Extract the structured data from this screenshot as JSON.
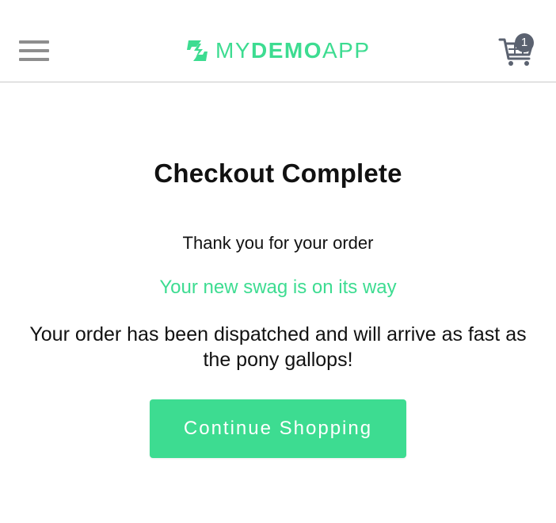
{
  "header": {
    "logo_my": "MY",
    "logo_demo": "DEMO",
    "logo_app": "APP",
    "cart_count": "1"
  },
  "main": {
    "title": "Checkout Complete",
    "thanks": "Thank you for your order",
    "swag": "Your new swag is on its way",
    "dispatched": "Your order has been dispatched and will arrive as fast as the pony gallops!",
    "continue_label": "Continue Shopping"
  },
  "colors": {
    "brand": "#3ddc91",
    "badge": "#5b6270",
    "menu": "#8e8e8e"
  },
  "icons": {
    "menu": "hamburger-menu-icon",
    "logo": "logo-icon",
    "cart": "cart-icon"
  }
}
